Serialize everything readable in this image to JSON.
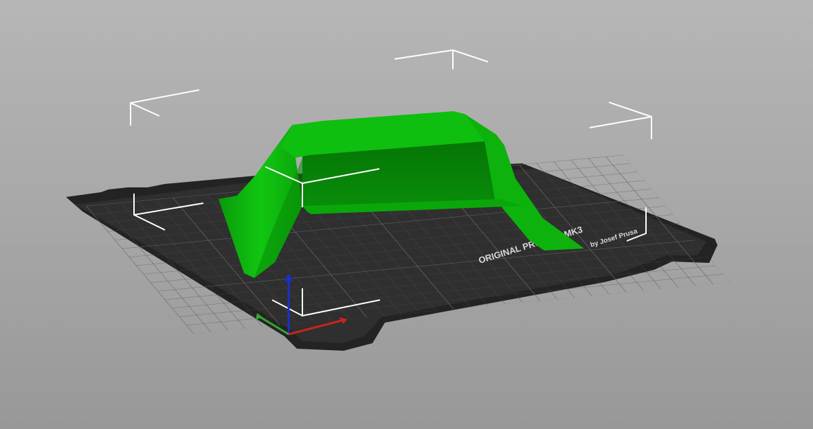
{
  "viewport": {
    "name": "3D build plate view",
    "background_color": "#a9a9a9"
  },
  "build_plate": {
    "surface_color": "#2e2e2e",
    "grid_color": "#5a5a5a",
    "label_line_1": "ORIGINAL PRUSA i3 MK3",
    "label_line_2": "by Josef Prusa"
  },
  "model": {
    "color": "#00b200",
    "selected": true
  },
  "axes": {
    "x_color": "#c8241e",
    "y_color": "#2fa82f",
    "z_color": "#1c2fd0"
  },
  "selection_box": {
    "color": "#ffffff"
  }
}
